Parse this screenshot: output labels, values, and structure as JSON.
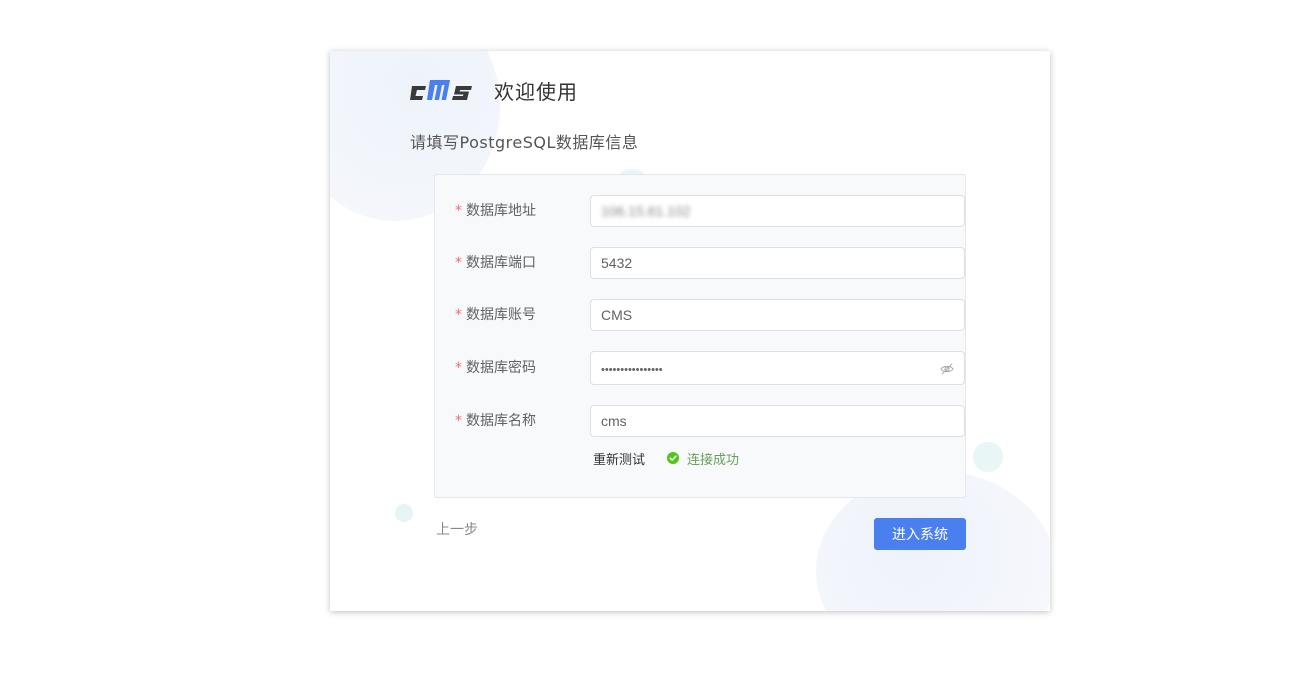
{
  "header": {
    "logo_text": "cms",
    "welcome": "欢迎使用"
  },
  "subtitle": "请填写PostgreSQL数据库信息",
  "form": {
    "fields": [
      {
        "label": "数据库地址",
        "value": "106.15.61.102",
        "required": true
      },
      {
        "label": "数据库端口",
        "value": "5432",
        "required": true
      },
      {
        "label": "数据库账号",
        "value": "CMS",
        "required": true
      },
      {
        "label": "数据库密码",
        "value": "••••••••••••••••",
        "required": true
      },
      {
        "label": "数据库名称",
        "value": "cms",
        "required": true
      }
    ],
    "required_mark": "*"
  },
  "status": {
    "retest_label": "重新测试",
    "success_label": "连接成功",
    "success_color": "#52c41a"
  },
  "actions": {
    "prev_label": "上一步",
    "enter_label": "进入系统"
  },
  "colors": {
    "primary": "#4a7fef",
    "logo_accent": "#4a7fef",
    "logo_dark": "#3a3a3a"
  }
}
